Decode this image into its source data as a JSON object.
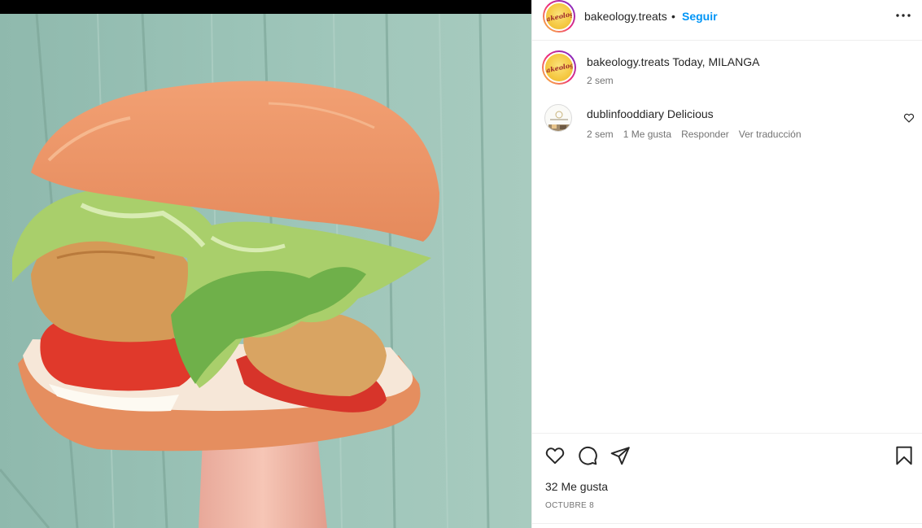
{
  "post": {
    "author": "bakeology.treats",
    "avatar_logo_text": "Bakeology",
    "follow_label": "Seguir",
    "separator": "•",
    "more_icon": "more-horizontal-icon",
    "caption": "Today, MILANGA",
    "caption_time": "2 sem"
  },
  "comments": [
    {
      "user": "dublinfooddiary",
      "text": "Delicious",
      "time": "2 sem",
      "likes": "1 Me gusta",
      "reply_label": "Responder",
      "translate_label": "Ver traducción"
    }
  ],
  "actions": {
    "icons": [
      "heart-icon",
      "comment-icon",
      "share-icon",
      "bookmark-icon"
    ],
    "likes_label": "32 Me gusta",
    "date_label": "OCTUBRE 8"
  },
  "colors": {
    "accent": "#0095f6",
    "text": "#262626",
    "secondary": "#737373",
    "border": "#efefef"
  }
}
